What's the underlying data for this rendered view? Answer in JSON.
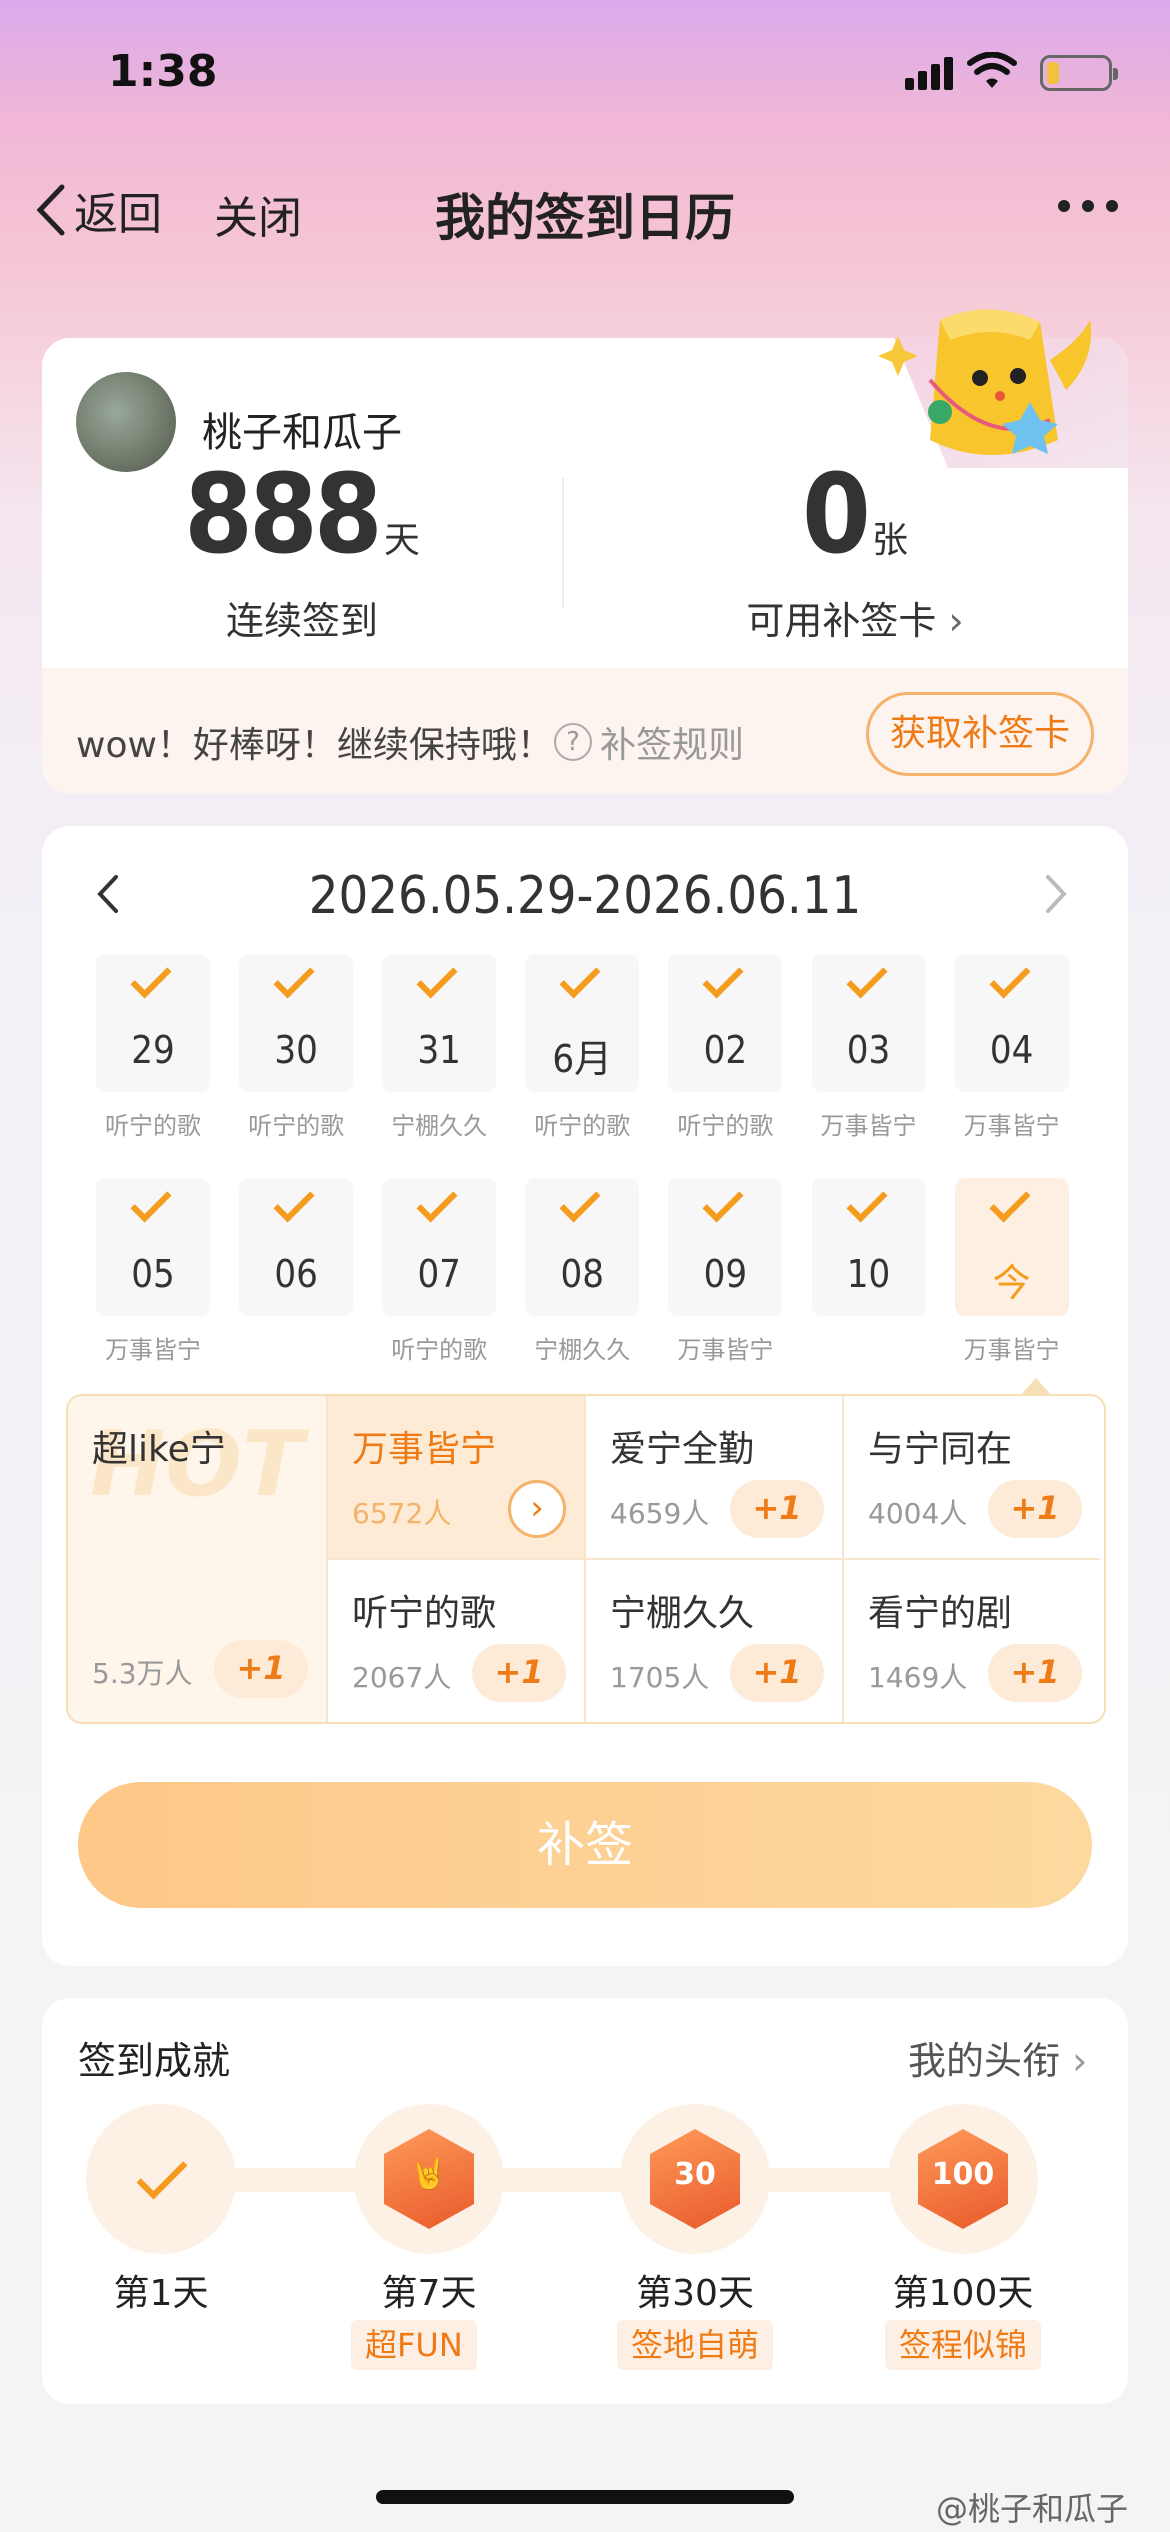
{
  "status_bar": {
    "time": "1:38"
  },
  "nav": {
    "back_label": "返回",
    "close_label": "关闭",
    "title": "我的签到日历"
  },
  "profile": {
    "username": "桃子和瓜子",
    "streak_value": "888",
    "streak_unit": "天",
    "streak_label": "连续签到",
    "cards_value": "0",
    "cards_unit": "张",
    "cards_label": "可用补签卡",
    "tip": "wow！好棒呀！继续保持哦！",
    "rule_label": "补签规则",
    "get_card_label": "获取补签卡"
  },
  "calendar": {
    "range": "2026.05.29-2026.06.11",
    "row1": [
      {
        "day": "29",
        "label": "听宁的歌"
      },
      {
        "day": "30",
        "label": "听宁的歌"
      },
      {
        "day": "31",
        "label": "宁棚久久"
      },
      {
        "day": "6月",
        "label": "听宁的歌"
      },
      {
        "day": "02",
        "label": "听宁的歌"
      },
      {
        "day": "03",
        "label": "万事皆宁"
      },
      {
        "day": "04",
        "label": "万事皆宁"
      }
    ],
    "row2": [
      {
        "day": "05",
        "label": "万事皆宁"
      },
      {
        "day": "06",
        "label": ""
      },
      {
        "day": "07",
        "label": "听宁的歌"
      },
      {
        "day": "08",
        "label": "宁棚久久"
      },
      {
        "day": "09",
        "label": "万事皆宁"
      },
      {
        "day": "10",
        "label": ""
      },
      {
        "day": "今",
        "label": "万事皆宁"
      }
    ]
  },
  "categories": {
    "hot_label": "HOT",
    "first": {
      "name": "超like宁",
      "count": "5.3万人",
      "plus": "+1"
    },
    "items": [
      {
        "name": "万事皆宁",
        "count": "6572人",
        "selected": true
      },
      {
        "name": "爱宁全勤",
        "count": "4659人",
        "plus": "+1"
      },
      {
        "name": "与宁同在",
        "count": "4004人",
        "plus": "+1"
      },
      {
        "name": "听宁的歌",
        "count": "2067人",
        "plus": "+1"
      },
      {
        "name": "宁棚久久",
        "count": "1705人",
        "plus": "+1"
      },
      {
        "name": "看宁的剧",
        "count": "1469人",
        "plus": "+1"
      }
    ],
    "resign_label": "补签"
  },
  "achievements": {
    "title": "签到成就",
    "link_label": "我的头衔",
    "items": [
      {
        "day": "第1天",
        "tag": "",
        "badge": ""
      },
      {
        "day": "第7天",
        "tag": "超FUN",
        "badge": "🤘"
      },
      {
        "day": "第30天",
        "tag": "签地自萌",
        "badge": "30"
      },
      {
        "day": "第100天",
        "tag": "签程似锦",
        "badge": "100"
      }
    ]
  },
  "watermark": "@桃子和瓜子",
  "colors": {
    "accent": "#f59c1f",
    "accent_text": "#ef7b17",
    "card_bg": "#ffffff"
  }
}
